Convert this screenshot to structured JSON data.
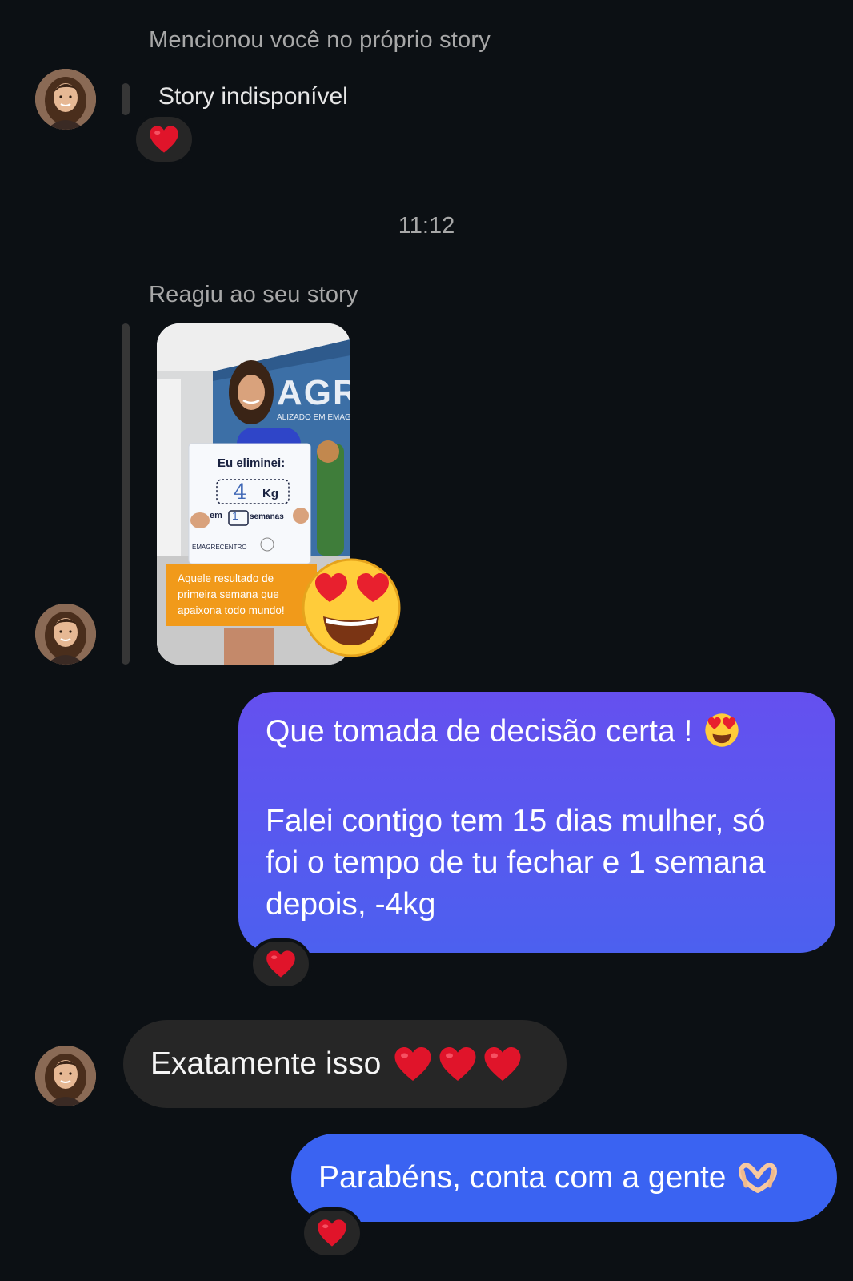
{
  "thread": {
    "mention_notice": "Mencionou você no próprio story",
    "story_unavailable": "Story indisponível",
    "timestamp": "11:12",
    "story_reaction_notice": "Reagiu ao seu story"
  },
  "story": {
    "wall_text": "AGREG",
    "wall_subtext": "ALIZADO EM EMAGR",
    "sign_title": "Eu eliminei:",
    "sign_weight_value": "4",
    "sign_weight_unit": "Kg",
    "sign_em": "em",
    "sign_weeks_value": "1",
    "sign_weeks_label": "semanas",
    "caption": "Aquele resultado de primeira semana que apaixona todo mundo!",
    "reaction_emoji": "heart-eyes-emoji"
  },
  "messages": {
    "msg1_line1": "Que tomada de decisão certa !",
    "msg1_line2": "Falei contigo tem 15 dias mulher, só",
    "msg1_line3": "foi o tempo de tu fechar e 1 semana",
    "msg1_line4": "depois, -4kg",
    "msg2_text": "Exatamente isso",
    "msg3_text": "Parabéns, conta com a gente"
  },
  "colors": {
    "background": "#0c1014",
    "outgoing_gradient_top": "#6550ef",
    "outgoing_gradient_bottom": "#4c60ef",
    "outgoing_blue": "#3a63f2",
    "incoming_bubble": "#262626",
    "heart": "#e0142a"
  },
  "icons": {
    "reaction": "red-heart-icon",
    "inline_1": "heart-eyes-emoji",
    "inline_2": "heart-hands-emoji"
  }
}
